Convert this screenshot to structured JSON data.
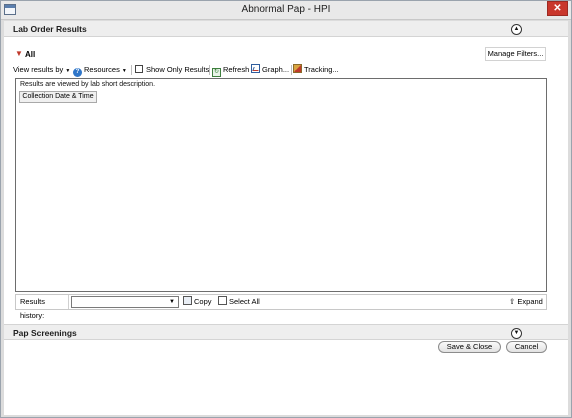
{
  "window": {
    "title": "Abnormal Pap - HPI",
    "close_glyph": "✕"
  },
  "lab_section": {
    "title": "Lab Order Results",
    "toggle_glyph": "▲"
  },
  "filter": {
    "label": "All",
    "manage_label": "Manage Filters..."
  },
  "toolbar": {
    "view_results_label": "View results by",
    "resources_label": "Resources",
    "show_only_results_label": "Show Only Results",
    "refresh_label": "Refresh",
    "graph_label": "Graph...",
    "tracking_label": "Tracking..."
  },
  "results": {
    "note": "Results are viewed by lab short description.",
    "column_header": "Collection Date & Time"
  },
  "history": {
    "label": "Results history:",
    "selected_value": "",
    "copy_label": "Copy",
    "select_all_label": "Select All",
    "expand_label": "Expand"
  },
  "pap_section": {
    "title": "Pap Screenings",
    "toggle_glyph": "▼"
  },
  "footer": {
    "save_close_label": "Save & Close",
    "cancel_label": "Cancel"
  },
  "icons": {
    "filter": "filter-icon",
    "help": "help-icon",
    "refresh": "refresh-icon",
    "graph": "graph-icon",
    "tracking": "tracking-icon",
    "copy": "copy-icon",
    "select_all": "select-all-icon",
    "expand": "expand-icon"
  },
  "colors": {
    "close_button": "#c9372c",
    "section_header": "#eeeeee",
    "filter_icon": "#c0392b"
  }
}
